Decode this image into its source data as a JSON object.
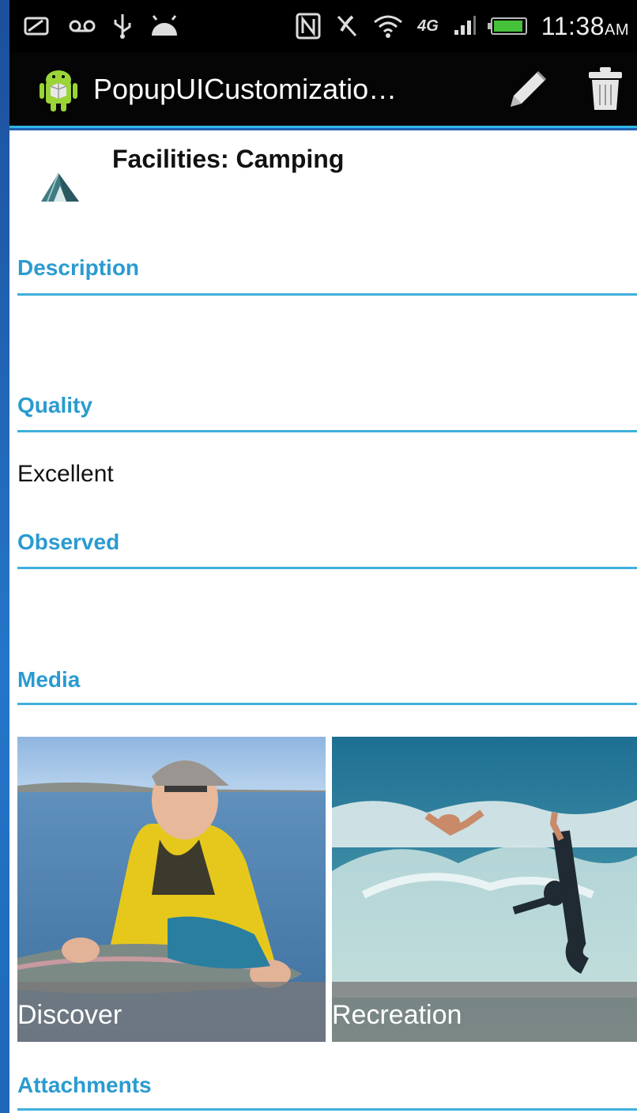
{
  "status_bar": {
    "time": "11:38",
    "ampm": "AM",
    "icons": [
      "voicemail-icon",
      "usb-icon",
      "android-debug-icon",
      "nfc-icon",
      "mute-icon",
      "wifi-icon",
      "4g-icon",
      "signal-icon",
      "battery-icon"
    ]
  },
  "action_bar": {
    "title": "PopupUICustomizatio…",
    "actions": [
      "edit-pencil-icon",
      "delete-trash-icon"
    ]
  },
  "popup": {
    "title": "Facilities: Camping",
    "icon": "tent-icon"
  },
  "fields": {
    "description_label": "Description",
    "description_value": "",
    "quality_label": "Quality",
    "quality_value": "Excellent",
    "observed_label": "Observed",
    "observed_value": "",
    "media_label": "Media",
    "attachments_label": "Attachments"
  },
  "media": [
    {
      "caption": "Discover"
    },
    {
      "caption": "Recreation"
    }
  ],
  "colors": {
    "accent": "#33b5e5",
    "section_label": "#2a9bd0",
    "action_bar_bg": "#050505",
    "battery": "#46c23a"
  }
}
